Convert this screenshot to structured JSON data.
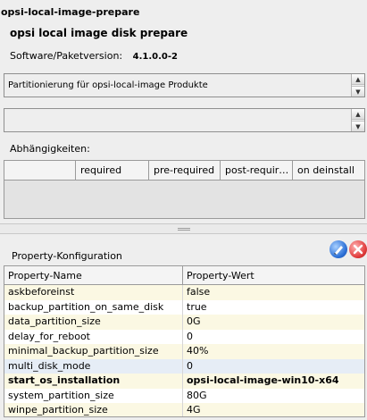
{
  "window": {
    "title": "opsi-local-image-prepare"
  },
  "product": {
    "name": "opsi local image disk prepare",
    "version_label": "Software/Paketversion:",
    "version_value": "4.1.0.0-2"
  },
  "description": {
    "text": "Partitionierung für opsi-local-image Produkte"
  },
  "advice": {
    "text": ""
  },
  "dependencies": {
    "label": "Abhängigkeiten:",
    "columns": [
      "",
      "required",
      "pre-required",
      "post-requir…",
      "on deinstall"
    ]
  },
  "properties": {
    "label": "Property-Konfiguration",
    "columns": [
      "Property-Name",
      "Property-Wert"
    ],
    "rows": [
      {
        "name": "askbeforeinst",
        "value": "false",
        "bg": "#fbf8e3",
        "bold": false
      },
      {
        "name": "backup_partition_on_same_disk",
        "value": "true",
        "bg": "#ffffff",
        "bold": false
      },
      {
        "name": "data_partition_size",
        "value": "0G",
        "bg": "#fbf8e3",
        "bold": false
      },
      {
        "name": "delay_for_reboot",
        "value": "0",
        "bg": "#ffffff",
        "bold": false
      },
      {
        "name": "minimal_backup_partition_size",
        "value": "40%",
        "bg": "#fbf8e3",
        "bold": false
      },
      {
        "name": "multi_disk_mode",
        "value": "0",
        "bg": "#e6edf6",
        "bold": false
      },
      {
        "name": "start_os_installation",
        "value": "opsi-local-image-win10-x64",
        "bg": "#fbf8e3",
        "bold": true
      },
      {
        "name": "system_partition_size",
        "value": "80G",
        "bg": "#ffffff",
        "bold": false
      },
      {
        "name": "winpe_partition_size",
        "value": "4G",
        "bg": "#fbf8e3",
        "bold": false
      }
    ]
  },
  "icons": {
    "edit": "edit-properties-icon",
    "cancel": "cancel-icon"
  }
}
